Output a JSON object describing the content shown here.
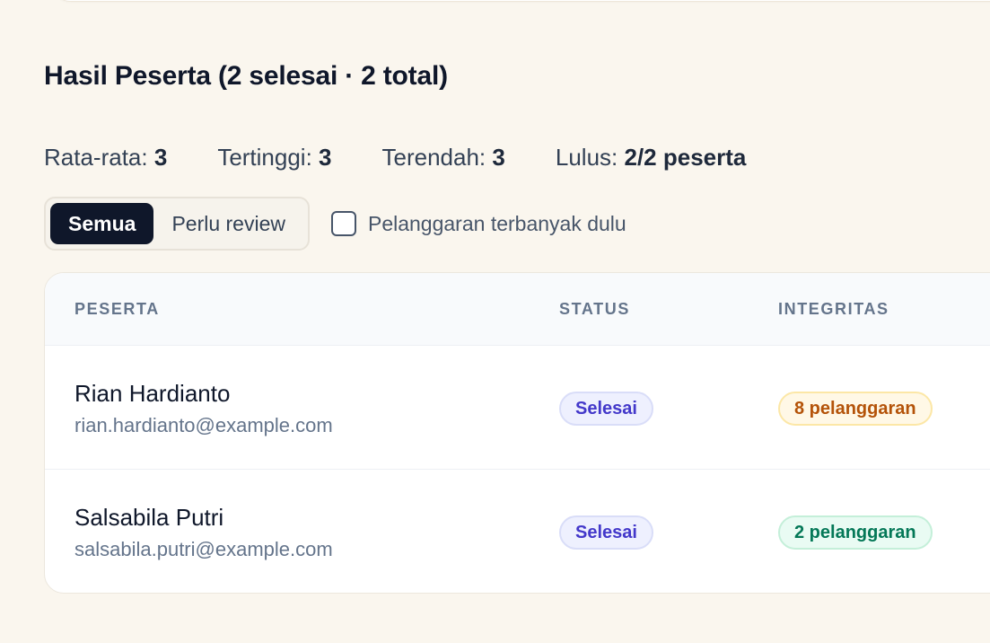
{
  "section": {
    "title": "Hasil Peserta (2 selesai · 2 total)"
  },
  "stats": [
    {
      "label": "Rata-rata:",
      "value": "3"
    },
    {
      "label": "Tertinggi:",
      "value": "3"
    },
    {
      "label": "Terendah:",
      "value": "3"
    },
    {
      "label": "Lulus:",
      "value": "2/2 peserta"
    }
  ],
  "filters": {
    "all_label": "Semua",
    "review_label": "Perlu review",
    "active": "Semua",
    "sort_checkbox_label": "Pelanggaran terbanyak dulu",
    "sort_checked": false
  },
  "table": {
    "headers": [
      "PESERTA",
      "STATUS",
      "INTEGRITAS"
    ],
    "rows": [
      {
        "name": "Rian Hardianto",
        "email": "rian.hardianto@example.com",
        "status": "Selesai",
        "integrity": "8 pelanggaran",
        "integrity_level": "warning"
      },
      {
        "name": "Salsabila Putri",
        "email": "salsabila.putri@example.com",
        "status": "Selesai",
        "integrity": "2 pelanggaran",
        "integrity_level": "ok"
      }
    ]
  },
  "colors": {
    "background": "#faf6ee",
    "primary_dark": "#0f172a",
    "status_badge": "#4338ca",
    "warning_badge": "#b45309",
    "ok_badge": "#047857"
  }
}
